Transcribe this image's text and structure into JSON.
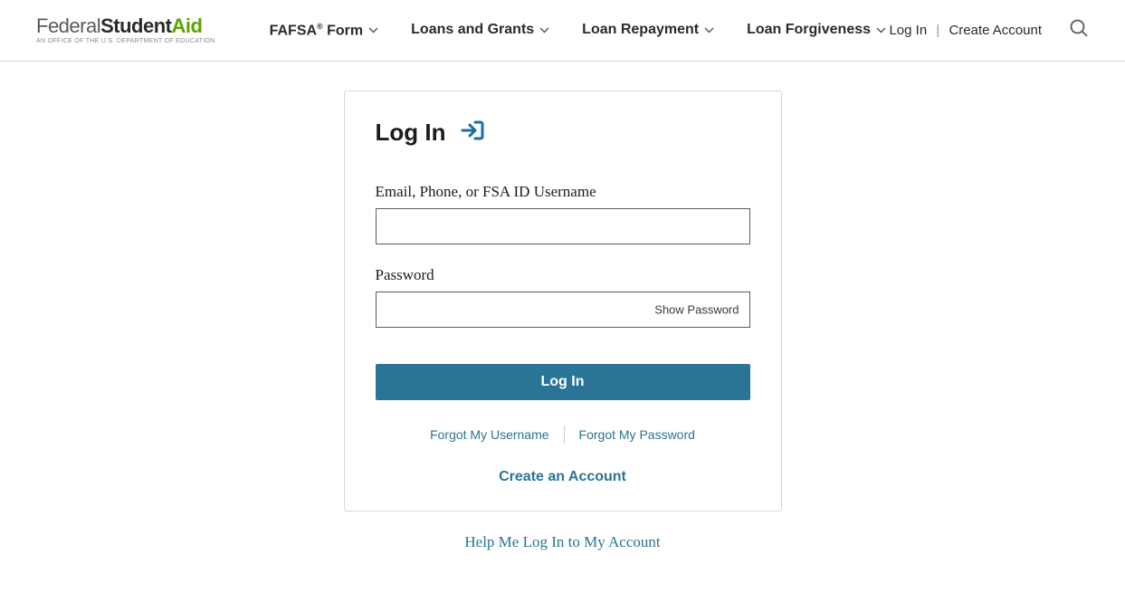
{
  "logo": {
    "federal": "Federal",
    "student": "Student",
    "aid": "Aid",
    "subtitle": "An OFFICE of the U.S. DEPARTMENT of EDUCATION"
  },
  "nav": {
    "items": [
      {
        "label": "FAFSA",
        "suffix": " Form",
        "has_sup": true,
        "sup": "®"
      },
      {
        "label": "Loans and Grants"
      },
      {
        "label": "Loan Repayment"
      },
      {
        "label": "Loan Forgiveness"
      }
    ]
  },
  "header_right": {
    "login": "Log In",
    "create": "Create Account"
  },
  "login_card": {
    "title": "Log In",
    "username_label": "Email, Phone, or FSA ID Username",
    "username_value": "",
    "password_label": "Password",
    "password_value": "",
    "show_password": "Show Password",
    "submit": "Log In",
    "forgot_username": "Forgot My Username",
    "forgot_password": "Forgot My Password",
    "create_account": "Create an Account"
  },
  "help_link": "Help Me Log In to My Account"
}
